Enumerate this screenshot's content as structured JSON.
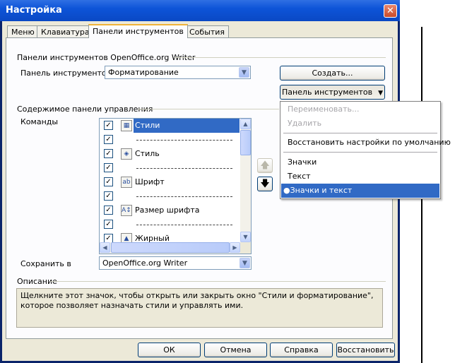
{
  "window": {
    "title": "Настройка"
  },
  "tabs": [
    {
      "label": "Меню"
    },
    {
      "label": "Клавиатура"
    },
    {
      "label": "Панели инструментов",
      "active": true
    },
    {
      "label": "События"
    }
  ],
  "toolbars_group": {
    "heading": "Панели инструментов OpenOffice.org Writer",
    "toolbar_label": "Панель инструментов",
    "toolbar_value": "Форматирование",
    "create_button": "Создать...",
    "toolbar_menu_button": "Панель инструментов"
  },
  "content_group": {
    "heading": "Содержимое панели управления",
    "commands_label": "Команды",
    "commands": [
      {
        "checked": true,
        "icon": "styles-icon",
        "label": "Стили",
        "selected": true
      },
      {
        "checked": true,
        "separator": true
      },
      {
        "checked": true,
        "icon": "paint-bucket-icon",
        "label": "Стиль"
      },
      {
        "checked": true,
        "separator": true
      },
      {
        "checked": true,
        "icon": "font-ab-icon",
        "label": "Шрифт"
      },
      {
        "checked": true,
        "separator": true
      },
      {
        "checked": true,
        "icon": "font-size-icon",
        "label": "Размер шрифта"
      },
      {
        "checked": true,
        "separator": true
      },
      {
        "checked": true,
        "icon": "bold-icon",
        "label": "Жирный"
      }
    ],
    "save_in_label": "Сохранить в",
    "save_in_value": "OpenOffice.org Writer"
  },
  "description": {
    "heading": "Описание",
    "text": "Щелкните этот значок, чтобы открыть или закрыть окно \"Стили и форматирование\", которое позволяет назначать стили и управлять ими."
  },
  "popup_menu": {
    "items": [
      {
        "label": "Переименовать...",
        "disabled": true
      },
      {
        "label": "Удалить",
        "disabled": true
      },
      {
        "label": "Восстановить настройки по умолчанию"
      },
      {
        "label": "Значки"
      },
      {
        "label": "Текст"
      },
      {
        "label": "Значки и текст",
        "selected": true,
        "mark": "●"
      }
    ]
  },
  "footer": {
    "ok": "ОК",
    "cancel": "Отмена",
    "help": "Справка",
    "reset": "Восстановить"
  }
}
